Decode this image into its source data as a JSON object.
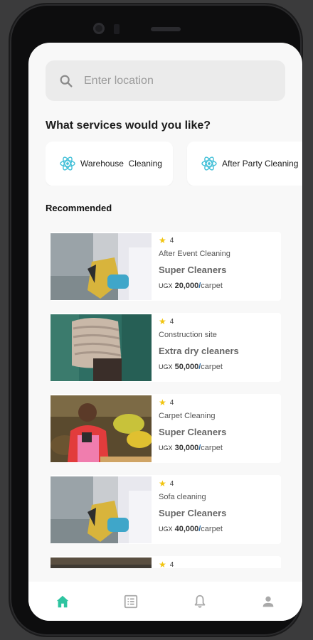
{
  "search": {
    "placeholder": "Enter location"
  },
  "services": {
    "title": "What services would you like?",
    "chips": [
      {
        "label": "Warehouse  Cleaning",
        "icon": "atom-icon"
      },
      {
        "label": "After Party Cleaning",
        "icon": "atom-icon"
      }
    ]
  },
  "recommended": {
    "title": "Recommended",
    "items": [
      {
        "rating": "4",
        "category": "After Event Cleaning",
        "company": "Super Cleaners",
        "currency": "UGX",
        "amount": "20,000",
        "unit": "carpet"
      },
      {
        "rating": "4",
        "category": "Construction site",
        "company": "Extra dry cleaners",
        "currency": "UGX",
        "amount": "50,000",
        "unit": "carpet"
      },
      {
        "rating": "4",
        "category": "Carpet Cleaning",
        "company": "Super Cleaners",
        "currency": "UGX",
        "amount": "30,000",
        "unit": "carpet"
      },
      {
        "rating": "4",
        "category": "Sofa cleaning",
        "company": "Super Cleaners",
        "currency": "UGX",
        "amount": "40,000",
        "unit": "carpet"
      },
      {
        "rating": "4",
        "category": "",
        "company": "",
        "currency": "",
        "amount": "",
        "unit": ""
      }
    ]
  },
  "nav": {
    "items": [
      {
        "icon": "home-icon",
        "active": true
      },
      {
        "icon": "list-icon",
        "active": false
      },
      {
        "icon": "bell-icon",
        "active": false
      },
      {
        "icon": "person-icon",
        "active": false
      }
    ],
    "active_color": "#2ec4a0",
    "inactive_color": "#a9a9a9"
  },
  "colors": {
    "accent": "#2ec4a0",
    "star": "#f1c40f",
    "price_slash": "#2d6ea8",
    "chip_icon": "#43c0d8"
  }
}
